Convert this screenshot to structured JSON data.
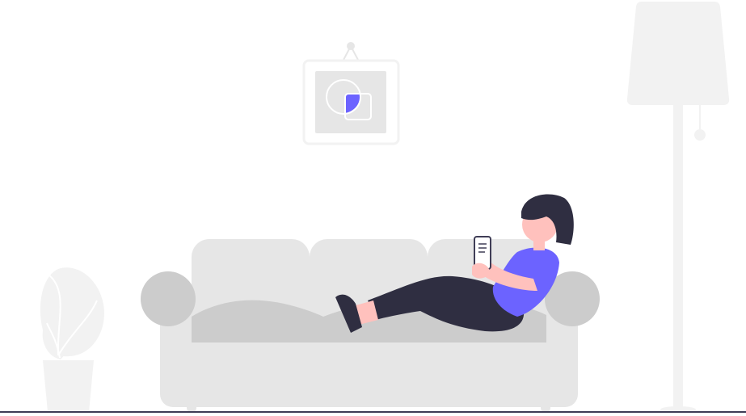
{
  "colors": {
    "background": "#ffffff",
    "furniture_light": "#f2f2f2",
    "furniture_mid": "#e6e6e6",
    "furniture_dark": "#cccccc",
    "accent": "#6c63ff",
    "hair_pants": "#2f2e41",
    "skin": "#ffc1bd",
    "floor": "#3f3d56"
  }
}
